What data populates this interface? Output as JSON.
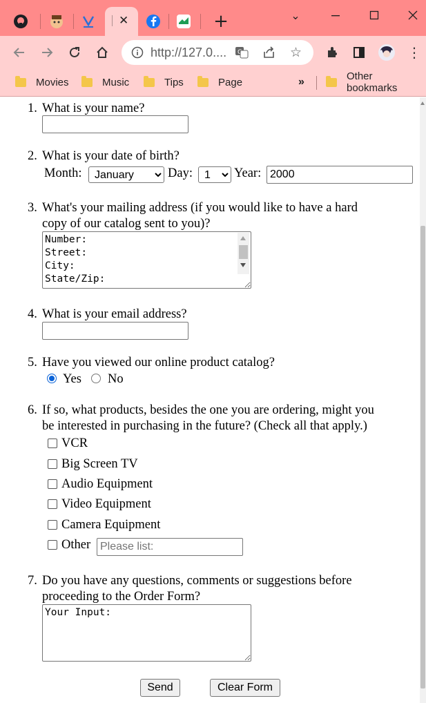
{
  "browser": {
    "url": "http://127.0....",
    "window_controls": {
      "minimize_icon": "⌄",
      "restore_icon": "⌄",
      "close_icon": "✕"
    },
    "new_tab_label": "+",
    "bookmarks": [
      {
        "label": "Movies"
      },
      {
        "label": "Music"
      },
      {
        "label": "Tips"
      },
      {
        "label": "Page"
      }
    ],
    "more_bookmarks_label": "»",
    "other_bookmarks_label": "Other bookmarks"
  },
  "form": {
    "q1": {
      "number": "1.",
      "text": "What is your name?",
      "value": ""
    },
    "q2": {
      "number": "2.",
      "text": "What is your date of birth?",
      "month_label": "Month:",
      "month_value": "January",
      "day_label": "Day:",
      "day_value": "1",
      "year_label": "Year:",
      "year_value": "2000"
    },
    "q3": {
      "number": "3.",
      "line1": "What's your mailing address (if you would like to have a hard",
      "line2": "copy of our catalog sent to you)?",
      "value": "Number:\nStreet:\nCity:\nState/Zip:"
    },
    "q4": {
      "number": "4.",
      "text": "What is your email address?",
      "value": ""
    },
    "q5": {
      "number": "5.",
      "text": "Have you viewed our online product catalog?",
      "yes_label": "Yes",
      "no_label": "No",
      "selected": "Yes"
    },
    "q6": {
      "number": "6.",
      "line1": "If so, what products, besides the one you are ordering, might you",
      "line2": "be interested in purchasing in the future? (Check all that apply.)",
      "options": [
        "VCR",
        "Big Screen TV",
        "Audio Equipment",
        "Video Equipment",
        "Camera Equipment",
        "Other"
      ],
      "other_placeholder": "Please list:"
    },
    "q7": {
      "number": "7.",
      "line1": "Do you have any questions, comments or suggestions before",
      "line2": "proceeding to the Order Form?",
      "value": "Your Input:"
    },
    "send_label": "Send",
    "clear_label": "Clear Form"
  },
  "colors": {
    "tab_strip": "#ff8a8a",
    "toolbar": "#ffd0d0",
    "radio_accent": "#0b63d8"
  }
}
